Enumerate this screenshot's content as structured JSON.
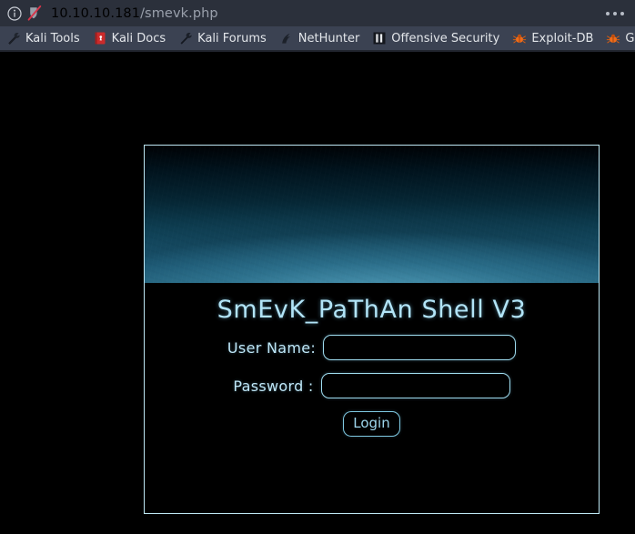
{
  "browser": {
    "url": {
      "host": "10.10.10.181",
      "path": "/smevk.php"
    },
    "icons": {
      "info": "info-circle-icon",
      "shield": "shield-disabled-icon",
      "more": "more-options-icon"
    },
    "bookmarks": [
      {
        "label": "Kali Tools",
        "icon": "kali-tools-wrench-icon"
      },
      {
        "label": "Kali Docs",
        "icon": "kali-docs-book-icon"
      },
      {
        "label": "Kali Forums",
        "icon": "kali-forums-wrench-icon"
      },
      {
        "label": "NetHunter",
        "icon": "nethunter-dragon-icon"
      },
      {
        "label": "Offensive Security",
        "icon": "offensive-security-icon"
      },
      {
        "label": "Exploit-DB",
        "icon": "exploit-db-bug-icon"
      },
      {
        "label": "GHD",
        "icon": "ghdb-bug-icon"
      }
    ]
  },
  "shell": {
    "title": "SmEvK_PaThAn Shell V3",
    "form": {
      "username": {
        "label": "User Name:",
        "value": "",
        "placeholder": ""
      },
      "password": {
        "label": "Password :",
        "value": "",
        "placeholder": ""
      },
      "submit_label": "Login"
    }
  },
  "colors": {
    "page_background": "#000000",
    "accent_cyan": "#9fdcef",
    "title_text": "#b2e4f7",
    "chrome_urlbar": "#2b303b",
    "chrome_bookmarks": "#3b4252",
    "banner_deep": "#2a7290"
  }
}
